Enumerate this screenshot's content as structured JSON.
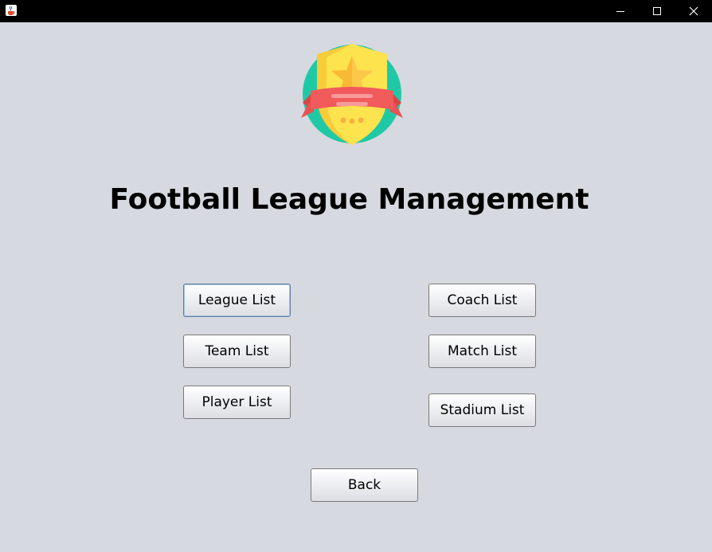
{
  "window": {
    "icon": "java-cup-icon",
    "controls": [
      "minimize-icon",
      "maximize-icon",
      "close-icon"
    ]
  },
  "logo": {
    "icon": "shield-star-badge-icon",
    "colors": {
      "circle": "#20c9a6",
      "shield": "#fde34d",
      "star": "#f9b934",
      "ribbon": "#f15b5b"
    }
  },
  "heading": "Football League Management",
  "buttons": {
    "league_list": "League List",
    "team_list": "Team List",
    "player_list": "Player List",
    "coach_list": "Coach List",
    "match_list": "Match List",
    "stadium_list": "Stadium List",
    "back": "Back"
  },
  "colors": {
    "background": "#d6d9df",
    "titlebar": "#000000",
    "focus_border": "#5c7ea8"
  }
}
